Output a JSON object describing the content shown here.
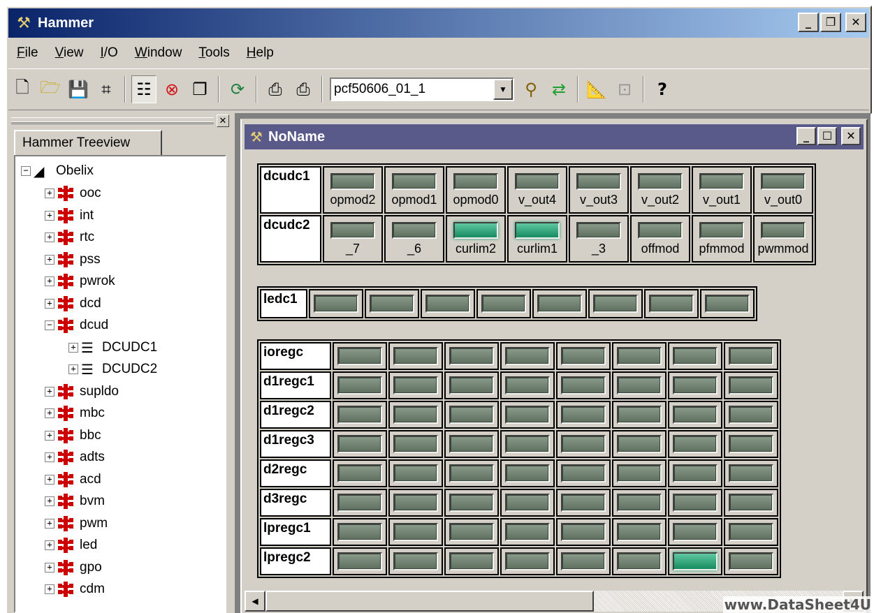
{
  "app": {
    "title": "Hammer",
    "window_buttons": {
      "minimize": "_",
      "restore": "🗗",
      "close": "✕"
    }
  },
  "menu": [
    {
      "label": "File",
      "accel": "F"
    },
    {
      "label": "View",
      "accel": "V"
    },
    {
      "label": "I/O",
      "accel": "I"
    },
    {
      "label": "Window",
      "accel": "W"
    },
    {
      "label": "Tools",
      "accel": "T"
    },
    {
      "label": "Help",
      "accel": "H"
    }
  ],
  "toolbar": {
    "device_combo_value": "pcf50606_01_1"
  },
  "tree": {
    "tab_label": "Hammer Treeview",
    "root": "Obelix",
    "items": [
      {
        "label": "ooc",
        "expanded": false
      },
      {
        "label": "int",
        "expanded": false
      },
      {
        "label": "rtc",
        "expanded": false
      },
      {
        "label": "pss",
        "expanded": false
      },
      {
        "label": "pwrok",
        "expanded": false
      },
      {
        "label": "dcd",
        "expanded": false
      },
      {
        "label": "dcud",
        "expanded": true,
        "children": [
          "DCUDC1",
          "DCUDC2"
        ]
      },
      {
        "label": "supldo",
        "expanded": false
      },
      {
        "label": "mbc",
        "expanded": false
      },
      {
        "label": "bbc",
        "expanded": false
      },
      {
        "label": "adts",
        "expanded": false
      },
      {
        "label": "acd",
        "expanded": false
      },
      {
        "label": "bvm",
        "expanded": false
      },
      {
        "label": "pwm",
        "expanded": false
      },
      {
        "label": "led",
        "expanded": false
      },
      {
        "label": "gpo",
        "expanded": false
      },
      {
        "label": "cdm",
        "expanded": false
      }
    ]
  },
  "child_window": {
    "title": "NoName",
    "dcudc": [
      {
        "name": "dcudc1",
        "bits": [
          {
            "label": "opmod2",
            "on": false
          },
          {
            "label": "opmod1",
            "on": false
          },
          {
            "label": "opmod0",
            "on": false
          },
          {
            "label": "v_out4",
            "on": false
          },
          {
            "label": "v_out3",
            "on": false
          },
          {
            "label": "v_out2",
            "on": false
          },
          {
            "label": "v_out1",
            "on": false
          },
          {
            "label": "v_out0",
            "on": false
          }
        ]
      },
      {
        "name": "dcudc2",
        "bits": [
          {
            "label": "_7",
            "on": false
          },
          {
            "label": "_6",
            "on": false
          },
          {
            "label": "curlim2",
            "on": true
          },
          {
            "label": "curlim1",
            "on": true
          },
          {
            "label": "_3",
            "on": false
          },
          {
            "label": "offmod",
            "on": false
          },
          {
            "label": "pfmmod",
            "on": false
          },
          {
            "label": "pwmmod",
            "on": false
          }
        ]
      }
    ],
    "ledc": {
      "name": "ledc1",
      "bits": [
        false,
        false,
        false,
        false,
        false,
        false,
        false,
        false
      ]
    },
    "regs": [
      {
        "name": "ioregc",
        "bits": [
          false,
          false,
          false,
          false,
          false,
          false,
          false,
          false
        ]
      },
      {
        "name": "d1regc1",
        "bits": [
          false,
          false,
          false,
          false,
          false,
          false,
          false,
          false
        ]
      },
      {
        "name": "d1regc2",
        "bits": [
          false,
          false,
          false,
          false,
          false,
          false,
          false,
          false
        ]
      },
      {
        "name": "d1regc3",
        "bits": [
          false,
          false,
          false,
          false,
          false,
          false,
          false,
          false
        ]
      },
      {
        "name": "d2regc",
        "bits": [
          false,
          false,
          false,
          false,
          false,
          false,
          false,
          false
        ]
      },
      {
        "name": "d3regc",
        "bits": [
          false,
          false,
          false,
          false,
          false,
          false,
          false,
          false
        ]
      },
      {
        "name": "lpregc1",
        "bits": [
          false,
          false,
          false,
          false,
          false,
          false,
          false,
          false
        ]
      },
      {
        "name": "lpregc2",
        "bits": [
          false,
          false,
          false,
          false,
          false,
          false,
          true,
          false
        ]
      }
    ]
  },
  "watermark": "www.DataSheet4U"
}
